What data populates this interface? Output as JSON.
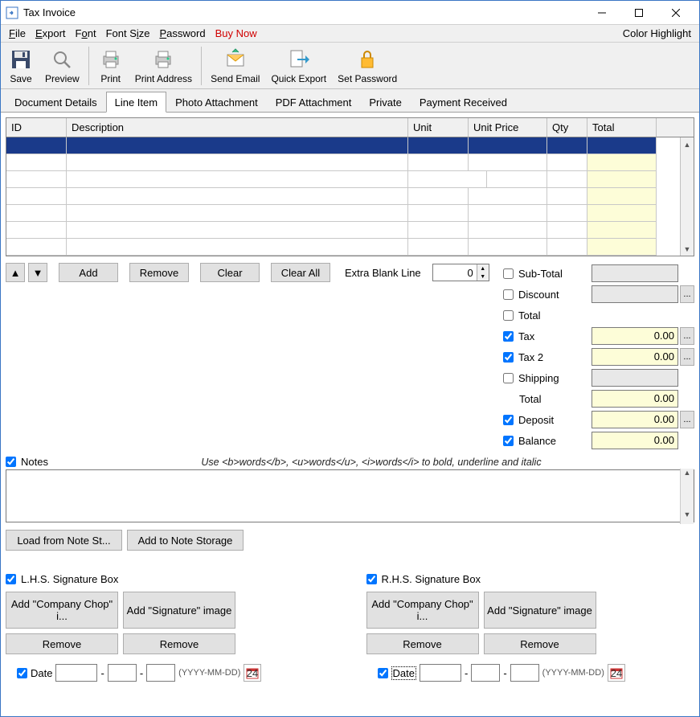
{
  "window": {
    "title": "Tax Invoice"
  },
  "menu": {
    "file": "File",
    "export": "Export",
    "font": "Font",
    "fontsize": "Font Size",
    "password": "Password",
    "buynow": "Buy Now",
    "colorhighlight": "Color Highlight"
  },
  "toolbar": {
    "save": "Save",
    "preview": "Preview",
    "print": "Print",
    "printaddress": "Print Address",
    "sendemail": "Send Email",
    "quickexport": "Quick Export",
    "setpassword": "Set Password"
  },
  "tabs": {
    "docdetails": "Document Details",
    "lineitem": "Line Item",
    "photo": "Photo Attachment",
    "pdf": "PDF Attachment",
    "private": "Private",
    "payment": "Payment Received"
  },
  "grid": {
    "headers": {
      "id": "ID",
      "desc": "Description",
      "unit": "Unit",
      "uprice": "Unit Price",
      "qty": "Qty",
      "total": "Total"
    }
  },
  "actions": {
    "add": "Add",
    "remove": "Remove",
    "clear": "Clear",
    "clearall": "Clear All",
    "extrablank": "Extra Blank Line",
    "extrablank_val": "0"
  },
  "totals": {
    "subtotal_lbl": "Sub-Total",
    "discount_lbl": "Discount",
    "total1_lbl": "Total",
    "tax_lbl": "Tax",
    "tax_val": "0.00",
    "tax2_lbl": "Tax 2",
    "tax2_val": "0.00",
    "shipping_lbl": "Shipping",
    "total2_lbl": "Total",
    "total2_val": "0.00",
    "deposit_lbl": "Deposit",
    "deposit_val": "0.00",
    "balance_lbl": "Balance",
    "balance_val": "0.00"
  },
  "notes": {
    "label": "Notes",
    "hint": "Use <b>words</b>, <u>words</u>, <i>words</i> to bold, underline and italic",
    "loadfrom": "Load from Note St...",
    "addto": "Add to Note Storage"
  },
  "sig": {
    "lhs_label": "L.H.S. Signature Box",
    "rhs_label": "R.H.S. Signature Box",
    "addchop": "Add \"Company Chop\" i...",
    "addsig": "Add \"Signature\" image",
    "remove": "Remove",
    "date": "Date",
    "datefmt": "(YYYY-MM-DD)"
  }
}
